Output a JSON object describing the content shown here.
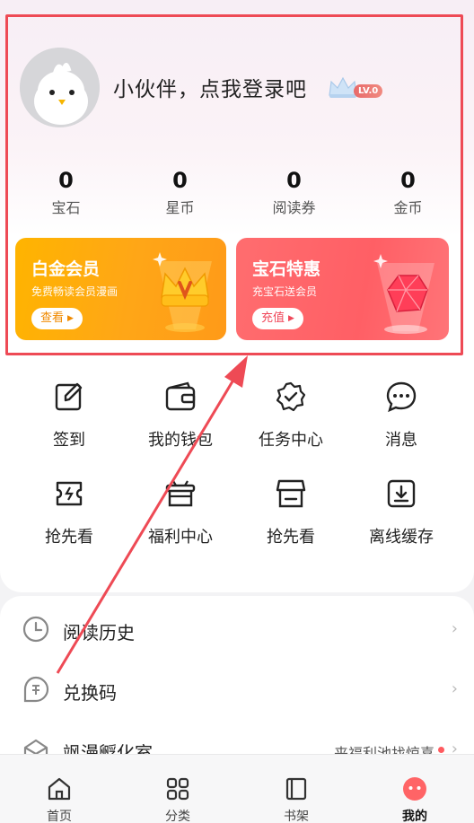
{
  "profile": {
    "login_prompt": "小伙伴，点我登录吧",
    "level_badge": "LV.0"
  },
  "stats": [
    {
      "value": "0",
      "label": "宝石"
    },
    {
      "value": "0",
      "label": "星币"
    },
    {
      "value": "0",
      "label": "阅读券"
    },
    {
      "value": "0",
      "label": "金币"
    }
  ],
  "cards": {
    "vip": {
      "title": "白金会员",
      "subtitle": "免费畅读会员漫画",
      "button": "查看"
    },
    "gem": {
      "title": "宝石特惠",
      "subtitle": "充宝石送会员",
      "button": "充值"
    }
  },
  "grid": [
    {
      "label": "签到",
      "icon": "checkin-icon"
    },
    {
      "label": "我的钱包",
      "icon": "wallet-icon"
    },
    {
      "label": "任务中心",
      "icon": "task-badge-icon"
    },
    {
      "label": "消息",
      "icon": "message-icon"
    },
    {
      "label": "抢先看",
      "icon": "ticket-icon"
    },
    {
      "label": "福利中心",
      "icon": "gift-pot-icon"
    },
    {
      "label": "抢先看",
      "icon": "store-icon"
    },
    {
      "label": "离线缓存",
      "icon": "download-icon"
    }
  ],
  "list": [
    {
      "label": "阅读历史",
      "icon": "clock-icon"
    },
    {
      "label": "兑换码",
      "icon": "redeem-icon"
    },
    {
      "label": "飒漫孵化室",
      "icon": "incubator-icon",
      "extra": "来福利池找惊喜"
    }
  ],
  "tabs": [
    {
      "label": "首页",
      "icon": "home-icon"
    },
    {
      "label": "分类",
      "icon": "grid-icon"
    },
    {
      "label": "书架",
      "icon": "bookshelf-icon"
    },
    {
      "label": "我的",
      "icon": "profile-face-icon"
    }
  ],
  "colors": {
    "annotation": "#ee4a55",
    "vip_card": "#ffa617",
    "gem_card": "#ff5f65",
    "accent": "#ff5a5f"
  }
}
